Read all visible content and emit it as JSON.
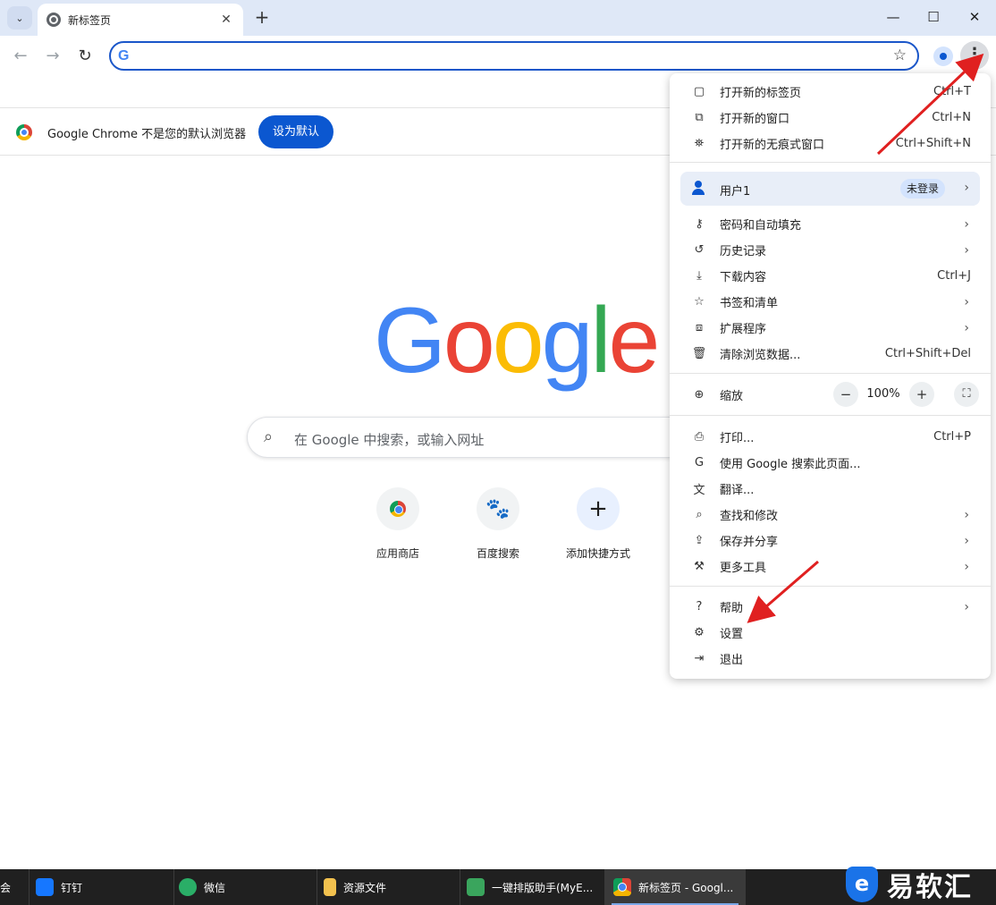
{
  "tabstrip": {
    "tab_title": "新标签页",
    "close_glyph": "✕",
    "new_tab_glyph": "+",
    "search_tabs_glyph": "⌄",
    "window_controls": {
      "minimize": "—",
      "maximize": "☐",
      "close": "✕"
    }
  },
  "toolbar": {
    "back_glyph": "←",
    "forward_glyph": "→",
    "reload_glyph": "↻",
    "omnibox_logo": "G",
    "omnibox_value": "",
    "bookmark_glyph": "☆",
    "menu_glyph": "⋮"
  },
  "infobar": {
    "message": "Google Chrome 不是您的默认浏览器",
    "button": "设为默认"
  },
  "ntp": {
    "logo_letters": [
      {
        "ch": "G",
        "color": "#4285f4"
      },
      {
        "ch": "o",
        "color": "#ea4335"
      },
      {
        "ch": "o",
        "color": "#fbbc05"
      },
      {
        "ch": "g",
        "color": "#4285f4"
      },
      {
        "ch": "l",
        "color": "#34a853"
      },
      {
        "ch": "e",
        "color": "#ea4335"
      }
    ],
    "search_placeholder": "在 Google 中搜索，或输入网址",
    "shortcuts": [
      {
        "label": "应用商店"
      },
      {
        "label": "百度搜索",
        "glyph": "🐾"
      },
      {
        "label": "添加快捷方式",
        "glyph": "+"
      }
    ]
  },
  "menu": {
    "group1": [
      {
        "icon": "▢",
        "label": "打开新的标签页",
        "shortcut": "Ctrl+T"
      },
      {
        "icon": "⧉",
        "label": "打开新的窗口",
        "shortcut": "Ctrl+N"
      },
      {
        "icon": "⛯",
        "label": "打开新的无痕式窗口",
        "shortcut": "Ctrl+Shift+N"
      }
    ],
    "user": {
      "label": "用户1",
      "badge": "未登录",
      "arrow": "›"
    },
    "group2": [
      {
        "icon": "⚷",
        "label": "密码和自动填充",
        "arrow": "›"
      },
      {
        "icon": "↺",
        "label": "历史记录",
        "arrow": "›"
      },
      {
        "icon": "⤓",
        "label": "下载内容",
        "shortcut": "Ctrl+J"
      },
      {
        "icon": "☆",
        "label": "书签和清单",
        "arrow": "›"
      },
      {
        "icon": "⧈",
        "label": "扩展程序",
        "arrow": "›"
      },
      {
        "icon": "🗑",
        "label": "清除浏览数据...",
        "shortcut": "Ctrl+Shift+Del"
      }
    ],
    "zoom": {
      "icon": "⊕",
      "label": "缩放",
      "minus": "−",
      "value": "100%",
      "plus": "+",
      "fullscreen": "⛶"
    },
    "group3": [
      {
        "icon": "⎙",
        "label": "打印...",
        "shortcut": "Ctrl+P"
      },
      {
        "icon": "G",
        "label": "使用 Google 搜索此页面..."
      },
      {
        "icon": "文",
        "label": "翻译..."
      },
      {
        "icon": "⌕",
        "label": "查找和修改",
        "arrow": "›"
      },
      {
        "icon": "⇪",
        "label": "保存并分享",
        "arrow": "›"
      },
      {
        "icon": "⚒",
        "label": "更多工具",
        "arrow": "›"
      }
    ],
    "group4": [
      {
        "icon": "?",
        "label": "帮助",
        "arrow": "›"
      },
      {
        "icon": "⚙",
        "label": "设置"
      },
      {
        "icon": "⇥",
        "label": "退出"
      }
    ]
  },
  "taskbar": {
    "items": [
      {
        "label": "钉钉",
        "color": "#1677ff"
      },
      {
        "label": "微信",
        "color": "#2aae67"
      },
      {
        "label": "资源文件",
        "color": "#f2c14e"
      },
      {
        "label": "一键排版助手(MyE...",
        "color": "#3aa55d"
      },
      {
        "label": "新标签页 - Googl...",
        "color": "#db4437"
      }
    ],
    "partial_left": "会"
  },
  "watermark": {
    "logo": "e",
    "text": "易软汇"
  }
}
